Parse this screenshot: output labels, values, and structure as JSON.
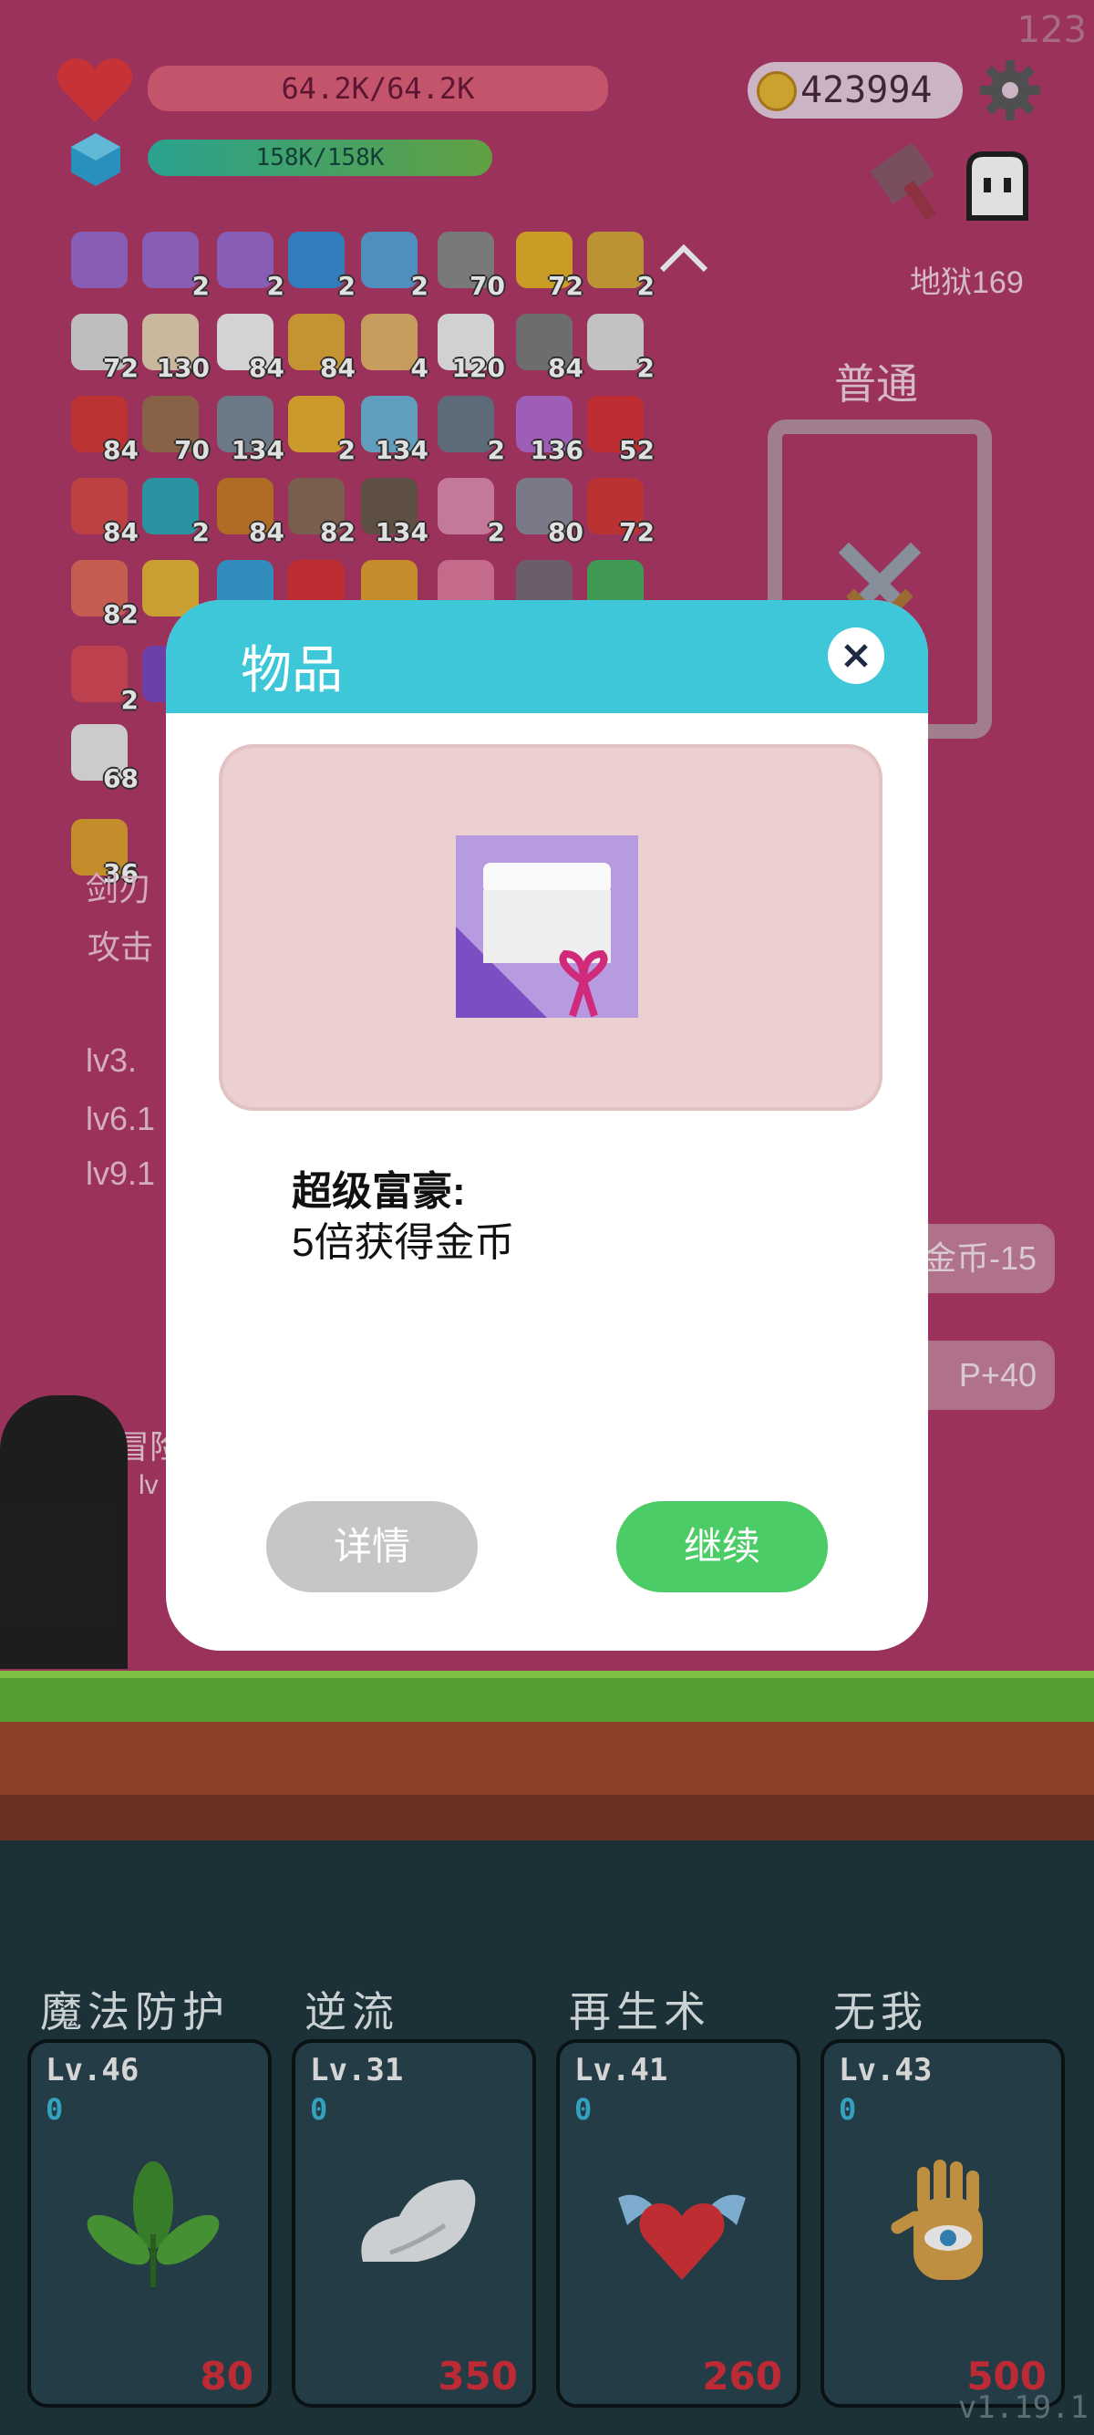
{
  "hud": {
    "score": "123",
    "hp": "64.2K/64.2K",
    "mp": "158K/158K",
    "coins": "423994",
    "stage": "地狱169",
    "mode": "普通"
  },
  "inventory": {
    "rows": [
      [
        {
          "icon": "gift-scroll-icon",
          "count": "",
          "color": "#9a6ad0"
        },
        {
          "icon": "gift-scroll-icon",
          "count": "2",
          "color": "#9a6ad0"
        },
        {
          "icon": "gift-scroll-icon",
          "count": "2",
          "color": "#9a6ad0"
        },
        {
          "icon": "star-card-icon",
          "count": "2",
          "color": "#3a8fd6"
        },
        {
          "icon": "shirt-icon",
          "count": "2",
          "color": "#5aa3d9"
        },
        {
          "icon": "stone-icon",
          "count": "70",
          "color": "#8a8a8a"
        },
        {
          "icon": "sunflower-icon",
          "count": "72",
          "color": "#e5b22b"
        },
        {
          "icon": "pineapple-icon",
          "count": "2",
          "color": "#d7a83a"
        }
      ],
      [
        {
          "icon": "envelope-icon",
          "count": "72",
          "color": "#d9d9d9"
        },
        {
          "icon": "flag-icon",
          "count": "130",
          "color": "#e6d2b4"
        },
        {
          "icon": "flower-icon",
          "count": "84",
          "color": "#f1f1f1"
        },
        {
          "icon": "coins-icon",
          "count": "84",
          "color": "#e1a93a"
        },
        {
          "icon": "scroll-icon",
          "count": "4",
          "color": "#e3b36b"
        },
        {
          "icon": "ghost-icon",
          "count": "120",
          "color": "#eeeeee"
        },
        {
          "icon": "meteor-icon",
          "count": "84",
          "color": "#7d7d7d"
        },
        {
          "icon": "cards-icon",
          "count": "2",
          "color": "#dddddd"
        }
      ],
      [
        {
          "icon": "sock-icon",
          "count": "84",
          "color": "#d83a3a"
        },
        {
          "icon": "coconut-icon",
          "count": "70",
          "color": "#9a7050"
        },
        {
          "icon": "spike-ball-icon",
          "count": "134",
          "color": "#7b8a9a"
        },
        {
          "icon": "beer-icon",
          "count": "2",
          "color": "#e8b030"
        },
        {
          "icon": "robot-icon",
          "count": "134",
          "color": "#6fb4d8"
        },
        {
          "icon": "mortar-icon",
          "count": "2",
          "color": "#6a7a8a"
        },
        {
          "icon": "lotus-icon",
          "count": "136",
          "color": "#b46ad0"
        },
        {
          "icon": "strawberry-icon",
          "count": "52",
          "color": "#d8343a"
        }
      ],
      [
        {
          "icon": "watermelon-icon",
          "count": "84",
          "color": "#d84a4a"
        },
        {
          "icon": "spiral-icon",
          "count": "2",
          "color": "#30a8b8"
        },
        {
          "icon": "book-icon",
          "count": "84",
          "color": "#c97a2a"
        },
        {
          "icon": "ring-icon",
          "count": "82",
          "color": "#8a6a5a"
        },
        {
          "icon": "ship-icon",
          "count": "134",
          "color": "#6a5a4a"
        },
        {
          "icon": "icecream-icon",
          "count": "2",
          "color": "#e08ab0"
        },
        {
          "icon": "sword-icon",
          "count": "80",
          "color": "#8a8a9a"
        },
        {
          "icon": "red-flag-icon",
          "count": "72",
          "color": "#d43a3a"
        }
      ],
      [
        {
          "icon": "meat-icon",
          "count": "82",
          "color": "#e06a5a"
        },
        {
          "icon": "crown-icon",
          "count": "",
          "color": "#e6b63a"
        },
        {
          "icon": "staff-icon",
          "count": "",
          "color": "#3aa0d8"
        },
        {
          "icon": "apple-icon",
          "count": "",
          "color": "#d8343a"
        },
        {
          "icon": "pineapple-icon",
          "count": "",
          "color": "#e0a030"
        },
        {
          "icon": "potion-icon",
          "count": "",
          "color": "#e07aa0"
        },
        {
          "icon": "lantern-icon",
          "count": "",
          "color": "#7a6a7a"
        },
        {
          "icon": "cash-icon",
          "count": "",
          "color": "#4ab060"
        }
      ],
      [
        {
          "icon": "shield-icon",
          "count": "2",
          "color": "#d84a5a"
        },
        {
          "icon": "wizard-hat-icon",
          "count": "",
          "color": "#7a4ac0"
        }
      ],
      [
        {
          "icon": "dice-icon",
          "count": "68",
          "color": "#e8e8e8"
        }
      ],
      [
        {
          "icon": "bread-icon",
          "count": "36",
          "color": "#e0a030"
        }
      ]
    ]
  },
  "side_texts": {
    "line1": "剑刃",
    "line2": "攻击",
    "lv3": "lv3.",
    "lv6": "lv6.1",
    "lv9": "lv9.1",
    "adventure": "冒险",
    "adventure_lv": "lv"
  },
  "side_buttons": {
    "coin_cost": "金币-15",
    "exp_gain": "P+40"
  },
  "modal": {
    "title": "物品",
    "item_name": "超级富豪:",
    "item_desc": "5倍获得金币",
    "details_label": "详情",
    "continue_label": "继续",
    "colors": {
      "header": "#3ec6d9",
      "continue": "#4ccc66",
      "details": "#c6c6c6"
    }
  },
  "skills": [
    {
      "name": "魔法防护",
      "level": "Lv.46",
      "value": "0",
      "cost": "80",
      "icon": "leaf-icon"
    },
    {
      "name": "逆流",
      "level": "Lv.31",
      "value": "0",
      "cost": "350",
      "icon": "wing-icon"
    },
    {
      "name": "再生术",
      "level": "Lv.41",
      "value": "0",
      "cost": "260",
      "icon": "winged-heart-icon"
    },
    {
      "name": "无我",
      "level": "Lv.43",
      "value": "0",
      "cost": "500",
      "icon": "eye-hand-icon"
    }
  ],
  "version": "v1.19.1"
}
